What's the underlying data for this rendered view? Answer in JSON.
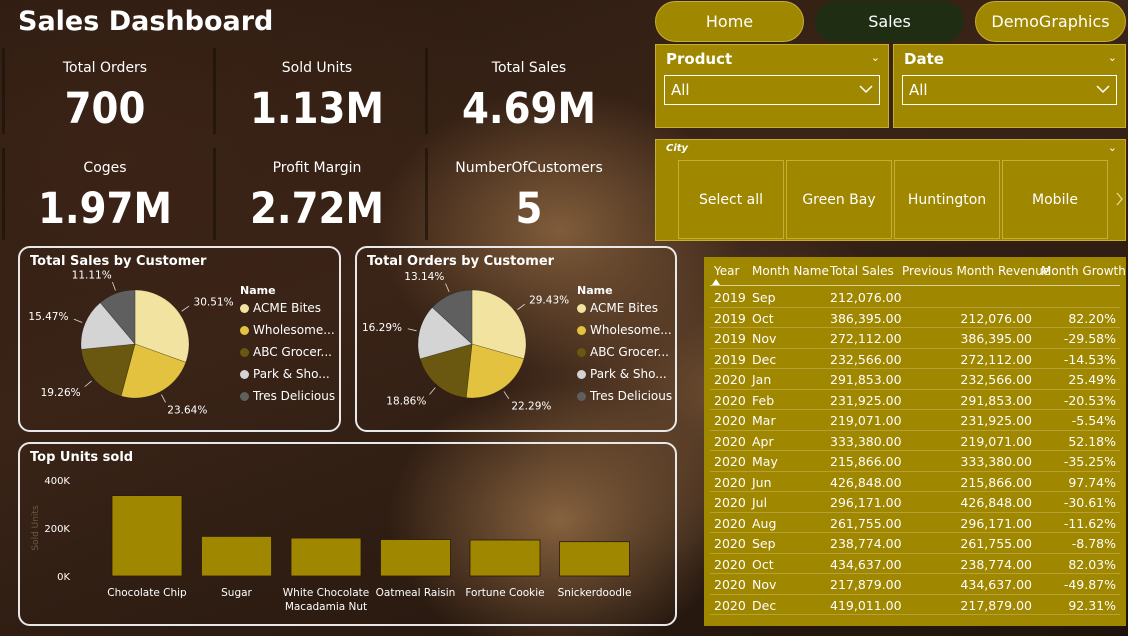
{
  "header": {
    "title": "Sales Dashboard"
  },
  "nav": [
    {
      "label": "Home"
    },
    {
      "label": "Sales"
    },
    {
      "label": "DemoGraphics"
    }
  ],
  "kpis": [
    {
      "label": "Total Orders",
      "value": "700"
    },
    {
      "label": "Sold Units",
      "value": "1.13M"
    },
    {
      "label": "Total Sales",
      "value": "4.69M"
    },
    {
      "label": "Coges",
      "value": "1.97M"
    },
    {
      "label": "Profit Margin",
      "value": "2.72M"
    },
    {
      "label": "NumberOfCustomers",
      "value": "5"
    }
  ],
  "filters": {
    "product": {
      "title": "Product",
      "value": "All"
    },
    "date": {
      "title": "Date",
      "value": "All"
    },
    "city": {
      "title": "City",
      "options": [
        "Select all",
        "Green Bay",
        "Huntington",
        "Mobile"
      ]
    }
  },
  "colors": {
    "gold": "#a08700",
    "nav_active": "#1f2e12",
    "slice_acme": "#f2e3a1",
    "slice_wholesome": "#e2c23f",
    "slice_abc": "#6a5710",
    "slice_park": "#d4d4d4",
    "slice_tres": "#5f5f5f"
  },
  "chart_data": [
    {
      "type": "pie",
      "title": "Total Sales by Customer",
      "legend_title": "Name",
      "legend_placement": "right",
      "labels": [
        "ACME Bites",
        "Wholesome...",
        "ABC Grocer...",
        "Park & Sho...",
        "Tres Delicious"
      ],
      "values": [
        30.51,
        23.64,
        19.26,
        15.47,
        11.11
      ],
      "value_labels": [
        "30.51%",
        "23.64%",
        "19.26%",
        "15.47%",
        "11.11%"
      ]
    },
    {
      "type": "pie",
      "title": "Total Orders by Customer",
      "legend_title": "Name",
      "legend_placement": "right",
      "labels": [
        "ACME Bites",
        "Wholesome...",
        "ABC Grocer...",
        "Park & Sho...",
        "Tres Delicious"
      ],
      "values": [
        29.43,
        22.29,
        18.86,
        16.29,
        13.14
      ],
      "value_labels": [
        "29.43%",
        "22.29%",
        "18.86%",
        "16.29%",
        "13.14%"
      ]
    },
    {
      "type": "bar",
      "title": "Top Units sold",
      "ylabel": "Sold Units",
      "ylim": [
        0,
        400000
      ],
      "y_ticks": [
        {
          "value": 0,
          "label": "0K"
        },
        {
          "value": 200000,
          "label": "200K"
        },
        {
          "value": 400000,
          "label": "400K"
        }
      ],
      "categories": [
        "Chocolate Chip",
        "Sugar",
        "White Chocolate Macadamia Nut",
        "Oatmeal Raisin",
        "Fortune Cookie",
        "Snickerdoodle"
      ],
      "category_lines": [
        [
          "Chocolate Chip"
        ],
        [
          "Sugar"
        ],
        [
          "White Chocolate",
          "Macadamia Nut"
        ],
        [
          "Oatmeal Raisin"
        ],
        [
          "Fortune Cookie"
        ],
        [
          "Snickerdoodle"
        ]
      ],
      "values": [
        335000,
        165000,
        158000,
        152000,
        150000,
        143000
      ],
      "grid": false
    }
  ],
  "table": {
    "columns": [
      "Year",
      "Month Name",
      "Total Sales",
      "Previous Month Revenue",
      "Month Growth"
    ],
    "rows": [
      [
        "2019",
        "Sep",
        "212,076.00",
        "",
        ""
      ],
      [
        "2019",
        "Oct",
        "386,395.00",
        "212,076.00",
        "82.20%"
      ],
      [
        "2019",
        "Nov",
        "272,112.00",
        "386,395.00",
        "-29.58%"
      ],
      [
        "2019",
        "Dec",
        "232,566.00",
        "272,112.00",
        "-14.53%"
      ],
      [
        "2020",
        "Jan",
        "291,853.00",
        "232,566.00",
        "25.49%"
      ],
      [
        "2020",
        "Feb",
        "231,925.00",
        "291,853.00",
        "-20.53%"
      ],
      [
        "2020",
        "Mar",
        "219,071.00",
        "231,925.00",
        "-5.54%"
      ],
      [
        "2020",
        "Apr",
        "333,380.00",
        "219,071.00",
        "52.18%"
      ],
      [
        "2020",
        "May",
        "215,866.00",
        "333,380.00",
        "-35.25%"
      ],
      [
        "2020",
        "Jun",
        "426,848.00",
        "215,866.00",
        "97.74%"
      ],
      [
        "2020",
        "Jul",
        "296,171.00",
        "426,848.00",
        "-30.61%"
      ],
      [
        "2020",
        "Aug",
        "261,755.00",
        "296,171.00",
        "-11.62%"
      ],
      [
        "2020",
        "Sep",
        "238,774.00",
        "261,755.00",
        "-8.78%"
      ],
      [
        "2020",
        "Oct",
        "434,637.00",
        "238,774.00",
        "82.03%"
      ],
      [
        "2020",
        "Nov",
        "217,879.00",
        "434,637.00",
        "-49.87%"
      ],
      [
        "2020",
        "Dec",
        "419,011.00",
        "217,879.00",
        "92.31%"
      ]
    ]
  }
}
